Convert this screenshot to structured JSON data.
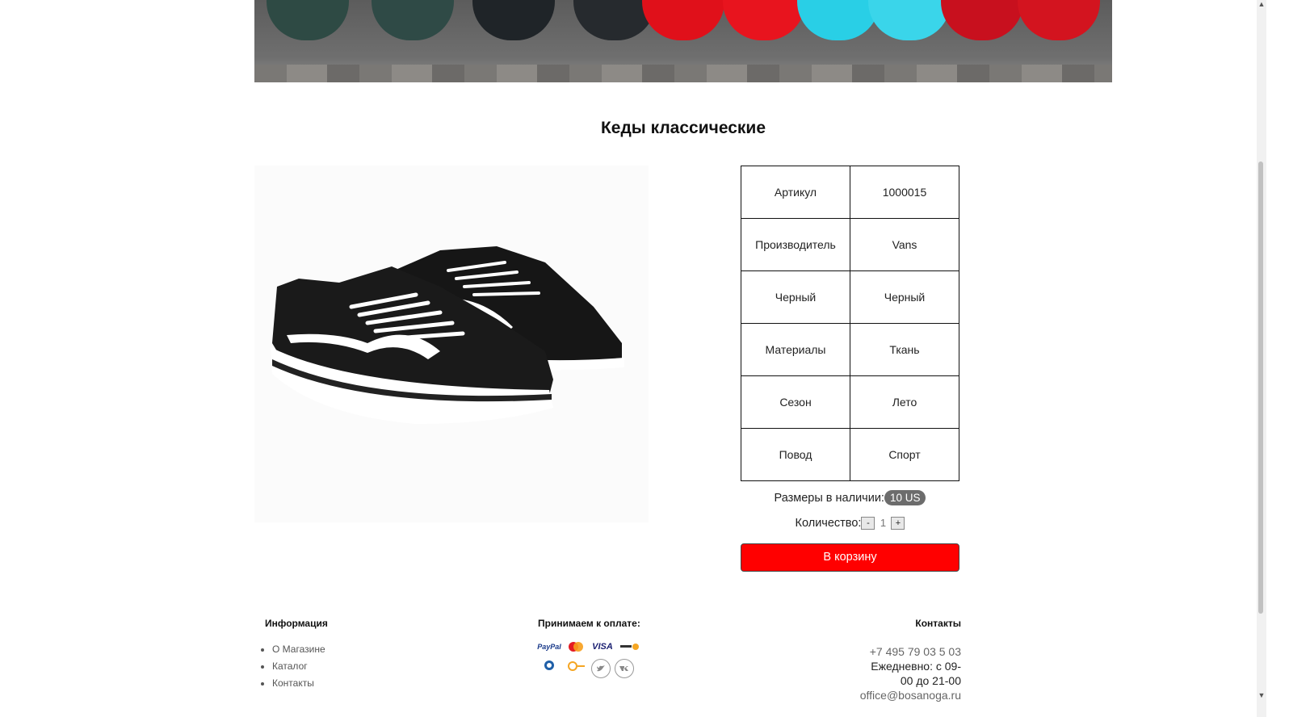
{
  "product": {
    "title": "Кеды классические",
    "specs": [
      {
        "label": "Артикул",
        "value": "1000015"
      },
      {
        "label": "Производитель",
        "value": "Vans"
      },
      {
        "label": "Черный",
        "value": "Черный"
      },
      {
        "label": "Материалы",
        "value": "Ткань"
      },
      {
        "label": "Сезон",
        "value": "Лето"
      },
      {
        "label": "Повод",
        "value": "Спорт"
      }
    ],
    "sizes_label": "Размеры в наличии:",
    "size": "10 US",
    "quantity_label": "Количество:",
    "quantity_minus": "-",
    "quantity_value": "1",
    "quantity_plus": "+",
    "cart_button": "В корзину"
  },
  "footer": {
    "info_heading": "Информация",
    "info_links": [
      "О Магазине",
      "Каталог",
      "Контакты"
    ],
    "payment_heading": "Принимаем к оплате:",
    "payment_icons": [
      "paypal-icon",
      "mastercard-icon",
      "visa-icon",
      "yandex-money-icon",
      "webmoney-icon",
      "qiwi-icon",
      "twitter-icon",
      "vk-icon"
    ],
    "payment_text": {
      "paypal": "PayPal",
      "visa": "VISA"
    },
    "contacts_heading": "Контакты",
    "phone": "+7 495 79 03 5 03",
    "hours_1": "Ежедневно: с 09-",
    "hours_2": "00 до 21-00",
    "email": "office@bosanoga.ru"
  },
  "colors": {
    "cart_button": "#ff0000",
    "size_badge": "#6c6c6c"
  }
}
